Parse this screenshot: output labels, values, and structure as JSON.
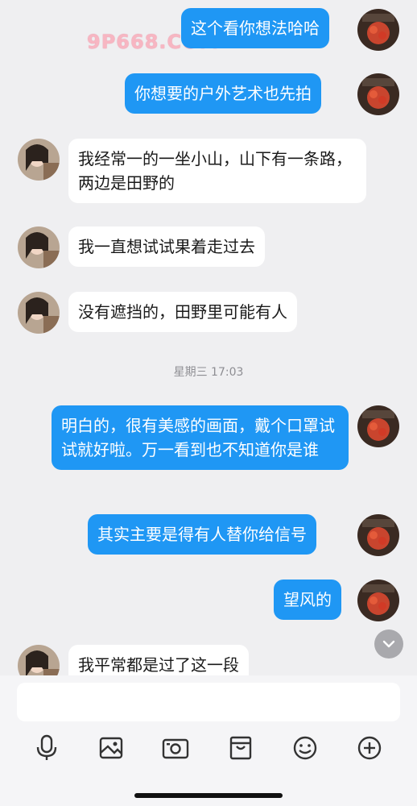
{
  "watermark": "9P668.COM",
  "timestamp": "星期三 17:03",
  "messages": [
    {
      "side": "me",
      "text": "这个看你想法哈哈"
    },
    {
      "side": "me",
      "text": "你想要的户外艺术也先拍"
    },
    {
      "side": "them",
      "text": "我经常一的一坐小山，山下有一条路，两边是田野的"
    },
    {
      "side": "them",
      "text": "我一直想试试果着走过去"
    },
    {
      "side": "them",
      "text": "没有遮挡的，田野里可能有人"
    },
    {
      "side": "me",
      "text": "明白的，很有美感的画面，戴个口罩试试就好啦。万一看到也不知道你是谁"
    },
    {
      "side": "me",
      "text": "其实主要是得有人替你给信号"
    },
    {
      "side": "me",
      "text": "望风的"
    },
    {
      "side": "them",
      "text": "我平常都是过了这一段"
    }
  ],
  "composer": {
    "placeholder": ""
  },
  "toolbar": [
    "mic-icon",
    "photo-icon",
    "camera-icon",
    "gift-icon",
    "emoji-icon",
    "plus-icon"
  ],
  "colors": {
    "outgoing_bubble": "#1f97f4",
    "incoming_bubble": "#ffffff",
    "background": "#efeff1"
  }
}
